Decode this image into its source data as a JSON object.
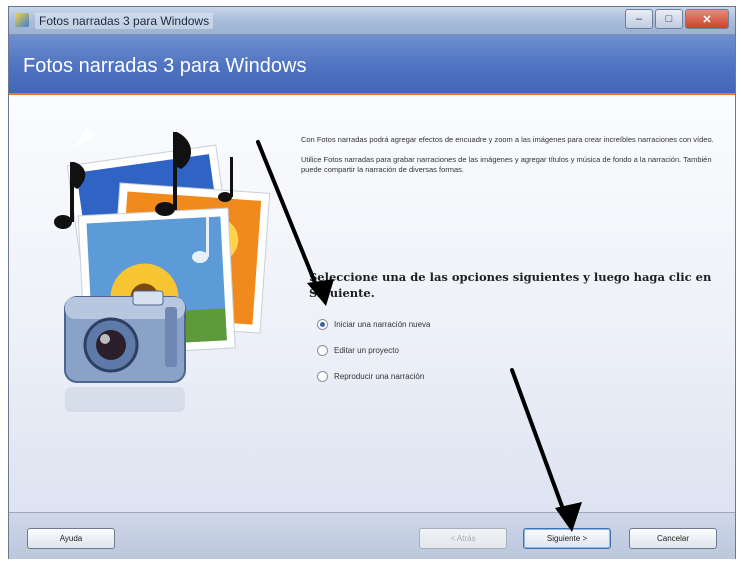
{
  "window": {
    "title": "Fotos narradas 3 para Windows",
    "controls": [
      "–",
      "□",
      "✕"
    ]
  },
  "header": {
    "title": "Fotos narradas 3 para Windows",
    "accent_color": "#e07a2e",
    "band_color": "#4f73c0"
  },
  "main": {
    "description": [
      "Con Fotos narradas podrá agregar efectos de encuadre y zoom a las imágenes para crear increíbles narraciones con vídeo.",
      "Utilice Fotos narradas para grabar narraciones de las imágenes y agregar títulos y música de fondo a la narración. También puede compartir la narración de diversas formas."
    ],
    "prompt": "Seleccione una de las opciones siguientes y luego haga clic en Siguiente.",
    "options": [
      {
        "label": "Iniciar una narración nueva",
        "selected": true
      },
      {
        "label": "Editar un proyecto",
        "selected": false
      },
      {
        "label": "Reproducir una narración",
        "selected": false
      }
    ]
  },
  "footer": {
    "help": "Ayuda",
    "back": "< Atrás",
    "next": "Siguiente >",
    "cancel": "Cancelar"
  }
}
